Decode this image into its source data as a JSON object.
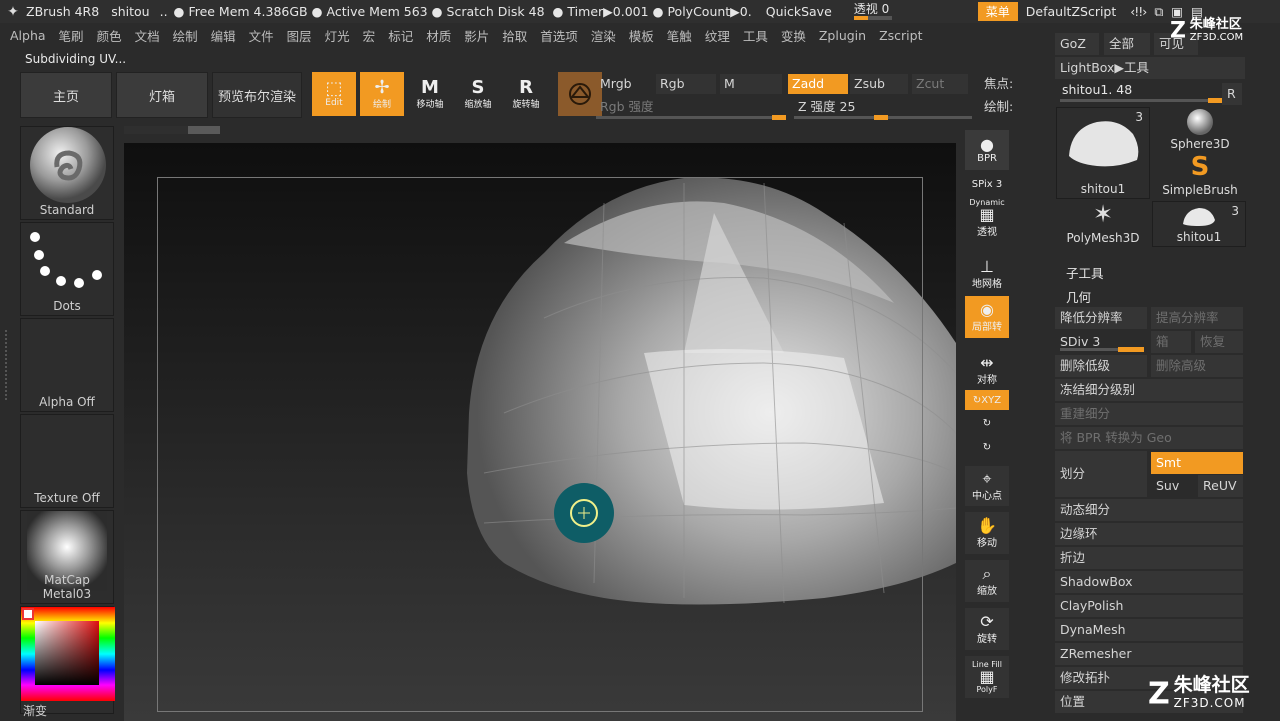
{
  "titlebar": {
    "app": "ZBrush 4R8",
    "doc": "shitou",
    "dots": "..",
    "free_mem": "Free Mem 4.386GB",
    "active_mem": "Active Mem 563",
    "scratch": "Scratch Disk 48",
    "timer": "Timer▶0.001",
    "polycount": "PolyCount▶0.",
    "quicksave": "QuickSave",
    "perspective": "透视",
    "perspective_value": "0",
    "perspective_level": 0.0,
    "menu_btn": "菜单",
    "script": "DefaultZScript"
  },
  "menubar": [
    "Alpha",
    "笔刷",
    "颜色",
    "文档",
    "绘制",
    "编辑",
    "文件",
    "图层",
    "灯光",
    "宏",
    "标记",
    "材质",
    "影片",
    "拾取",
    "首选项",
    "渲染",
    "模板",
    "笔触",
    "纹理",
    "工具",
    "变换",
    "Zplugin",
    "Zscript"
  ],
  "status_text": "Subdividing UV...",
  "topshelf": {
    "home": "主页",
    "lightbox": "灯箱",
    "bpr_preview": "预览布尔渲染",
    "edit": "Edit",
    "draw": "绘制",
    "move": "移动轴",
    "scale": "缩放轴",
    "rotate": "旋转轴"
  },
  "rgb": {
    "mrgb": "Mrgb",
    "rgb": "Rgb",
    "m": "M",
    "zadd": "Zadd",
    "zsub": "Zsub",
    "zcut": "Zcut",
    "rgb_intensity": "Rgb 强度",
    "z_intensity": "Z 强度",
    "z_intensity_value": "25",
    "focal": "焦点:",
    "draw_size": "绘制:"
  },
  "left": {
    "brush": "Standard",
    "stroke": "Dots",
    "alpha": "Alpha Off",
    "texture": "Texture Off",
    "material": "MatCap Metal03",
    "gradient": "渐变"
  },
  "right": {
    "bpr": "BPR",
    "spix": "SPix 3",
    "dynamic": "Dynamic",
    "persp": "透视",
    "floor": "地网格",
    "local": "局部转",
    "sym": "对称",
    "xyz": "XYZ",
    "center": "中心点",
    "move": "移动",
    "zoom": "缩放",
    "rotate": "旋转",
    "linefill": "Line Fill",
    "polyf": "PolyF"
  },
  "tool": {
    "goz": "GoZ",
    "all": "全部",
    "visible": "可见",
    "lightbox_tool": "LightBox▶工具",
    "current": "shitou1. 48",
    "r": "R",
    "thumbs": [
      {
        "label": "shitou1",
        "count": "3"
      },
      {
        "label": "Sphere3D",
        "count": ""
      },
      {
        "label": "SimpleBrush",
        "count": ""
      },
      {
        "label": "PolyMesh3D",
        "count": ""
      },
      {
        "label": "shitou1",
        "count": "3"
      }
    ],
    "subtool": "子工具",
    "geometry": "几何",
    "lower_res": "降低分辨率",
    "higher_res": "提高分辨率",
    "sdiv": "SDiv 3",
    "cage": "箱",
    "restore": "恢复",
    "del_lower": "删除低级",
    "del_higher": "删除高级",
    "freeze": "冻结细分级别",
    "reconstruct": "重建细分",
    "bpr_geo": "将 BPR 转换为 Geo",
    "divide": "划分",
    "smt": "Smt",
    "suv": "Suv",
    "reuv": "ReUV",
    "dynamic_sub": "动态细分",
    "edge_loop": "边缘环",
    "crease": "折边",
    "shadowbox": "ShadowBox",
    "claypolish": "ClayPolish",
    "dynamesh": "DynaMesh",
    "zremesher": "ZRemesher",
    "topology": "修改拓扑",
    "position": "位置"
  },
  "watermark": {
    "top_name": "朱峰社区",
    "top_url": "ZF3D.COM",
    "bottom_name": "朱峰社区",
    "bottom_url": "ZF3D.COM"
  },
  "colors": {
    "accent": "#f29a22",
    "bg": "#2b2b2b",
    "canvas": "#151515"
  }
}
